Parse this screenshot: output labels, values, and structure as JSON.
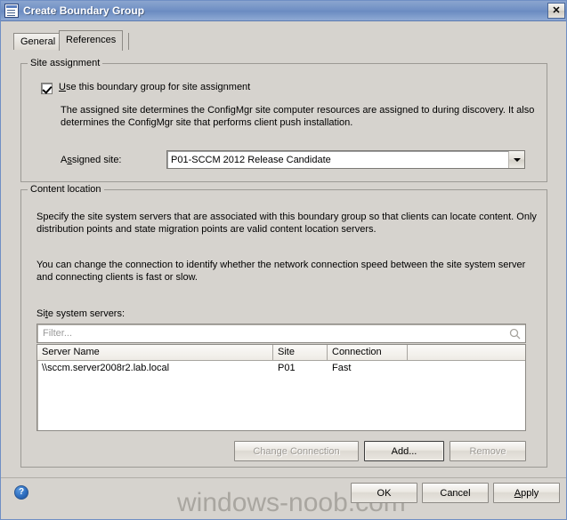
{
  "window": {
    "title": "Create Boundary Group",
    "icon": "window-document-icon",
    "close_label": "✕"
  },
  "tabs": [
    {
      "label": "General",
      "selected": false
    },
    {
      "label": "References",
      "selected": true
    }
  ],
  "site_assignment": {
    "group_title": "Site assignment",
    "checkbox": {
      "label_prefix": "U",
      "label_rest": "se this boundary group for site assignment",
      "checked": true
    },
    "description_line1": "The assigned site determines the ConfigMgr site computer resources are assigned to during discovery. It also",
    "description_line2": "determines the ConfigMgr site that performs client push installation.",
    "assigned_site_label_prefix": "A",
    "assigned_site_label_accel": "s",
    "assigned_site_label_rest": "signed site:",
    "assigned_site_value": "P01-SCCM 2012 Release Candidate"
  },
  "content_location": {
    "group_title": "Content location",
    "description_line1": "Specify the site system servers that are associated with this boundary group so that clients can locate content. Only",
    "description_line2": "distribution points and state migration points are valid content location servers.",
    "description_line3": "You can change the connection to identify whether the network connection speed between the site system server",
    "description_line4": "and connecting clients is fast or slow.",
    "list_label_prefix": "Si",
    "list_label_accel": "t",
    "list_label_rest": "e system servers:",
    "filter_placeholder": "Filter...",
    "filter_value": "",
    "filter_icon": "search-icon",
    "columns": [
      "Server Name",
      "Site",
      "Connection",
      ""
    ],
    "rows": [
      [
        "\\\\sccm.server2008r2.lab.local",
        "P01",
        "Fast",
        ""
      ]
    ],
    "buttons": {
      "change_connection": "Change Connection",
      "change_connection_enabled": false,
      "add": "Add...",
      "add_enabled": true,
      "remove": "Remove",
      "remove_enabled": false
    }
  },
  "footer": {
    "help_icon": "help-icon",
    "help_glyph": "?",
    "watermark": "windows-noob.com",
    "ok": "OK",
    "cancel": "Cancel",
    "apply": "Apply"
  },
  "colors": {
    "dialog_background": "#d6d3ce",
    "titlebar": "#6f8fc4",
    "field_background": "#ffffff",
    "disabled_text": "#9d9a95",
    "watermark": "#a9a6a0",
    "help_blue": "#2f6fc0"
  }
}
